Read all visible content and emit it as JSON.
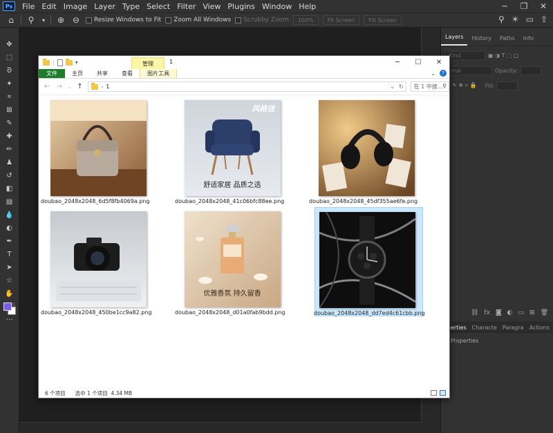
{
  "photoshop": {
    "logo": "Ps",
    "menu": [
      "File",
      "Edit",
      "Image",
      "Layer",
      "Type",
      "Select",
      "Filter",
      "View",
      "Plugins",
      "Window",
      "Help"
    ],
    "options": {
      "resize_windows": "Resize Windows to Fit",
      "zoom_all": "Zoom All Windows",
      "scrubby_zoom": "Scrubby Zoom",
      "zoom_value": "100%",
      "fit_screen": "Fit Screen",
      "fill_screen": "Fill Screen"
    },
    "panels": {
      "tabs": [
        "Layers",
        "History",
        "Paths",
        "Info"
      ],
      "active_tab": "Layers",
      "kind": "Kind",
      "blend": "rmal",
      "opacity_label": "Opacity:",
      "fill_label": "Fill:",
      "props_tabs": [
        "operties",
        "Characte",
        "Paragra",
        "Actions"
      ],
      "props_label": "Properties"
    },
    "swatches": {
      "foreground": "#7a5de8",
      "background": "#ffffff"
    }
  },
  "explorer": {
    "context_tab": "管理",
    "title": "1",
    "ribbon_tabs": {
      "file": "文件",
      "home": "主页",
      "share": "共享",
      "view": "查看",
      "picture_tools": "图片工具"
    },
    "address_path": "1",
    "search_placeholder": "在 1 中搜...",
    "files": [
      {
        "name": "doubao_2048x2048_6d5f8fb4069a.png",
        "selected": false
      },
      {
        "name": "doubao_2048x2048_41c06bfc88ee.png",
        "selected": false,
        "overlay_text": "舒适家居 品质之选",
        "brand": "风格佳"
      },
      {
        "name": "doubao_2048x2048_45df355ae6fe.png",
        "selected": false
      },
      {
        "name": "doubao_2048x2048_450be1cc9a82.png",
        "selected": false
      },
      {
        "name": "doubao_2048x2048_d01a0fab9bdd.png",
        "selected": false,
        "overlay_text": "优雅香氛 持久留香"
      },
      {
        "name": "doubao_2048x2048_dd7ed4c61cbb.png",
        "selected": true
      }
    ],
    "status": {
      "count": "6 个项目",
      "selected": "选中 1 个项目  4.34 MB"
    }
  }
}
